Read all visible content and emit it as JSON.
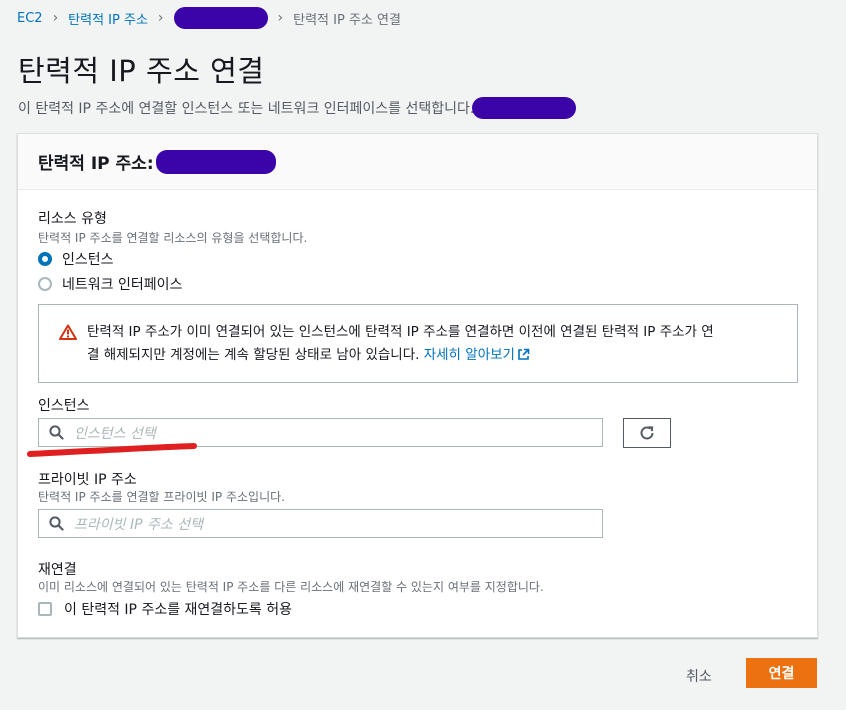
{
  "breadcrumb": {
    "items": [
      "EC2",
      "탄력적 IP 주소"
    ],
    "current": "탄력적 IP 주소 연결"
  },
  "page": {
    "title": "탄력적 IP 주소 연결",
    "description": "이 탄력적 IP 주소에 연결할 인스턴스 또는 네트워크 인터페이스를 선택합니다."
  },
  "panel": {
    "title": "탄력적 IP 주소:"
  },
  "resource_type": {
    "label": "리소스 유형",
    "hint": "탄력적 IP 주소를 연결할 리소스의 유형을 선택합니다.",
    "options": [
      {
        "label": "인스턴스",
        "checked": true
      },
      {
        "label": "네트워크 인터페이스",
        "checked": false
      }
    ]
  },
  "alert": {
    "line1": "탄력적 IP 주소가 이미 연결되어 있는 인스턴스에 탄력적 IP 주소를 연결하면 이전에 연결된 탄력적 IP 주소가 연",
    "line2": "결 해제되지만 계정에는 계속 할당된 상태로 남아 있습니다.",
    "link": "자세히 알아보기"
  },
  "instance": {
    "label": "인스턴스",
    "placeholder": "인스턴스 선택"
  },
  "private_ip": {
    "label": "프라이빗 IP 주소",
    "hint": "탄력적 IP 주소를 연결할 프라이빗 IP 주소입니다.",
    "placeholder": "프라이빗 IP 주소 선택"
  },
  "reassociation": {
    "label": "재연결",
    "hint": "이미 리소스에 연결되어 있는 탄력적 IP 주소를 다른 리소스에 재연결할 수 있는지 여부를 지정합니다.",
    "checkbox_label": "이 탄력적 IP 주소를 재연결하도록 허용",
    "checked": false
  },
  "actions": {
    "cancel": "취소",
    "associate": "연결"
  },
  "colors": {
    "primary_button": "#ec7211",
    "link": "#0073bb",
    "warning": "#d13212",
    "redaction": "#3a04a8",
    "annotation": "#e02020"
  }
}
